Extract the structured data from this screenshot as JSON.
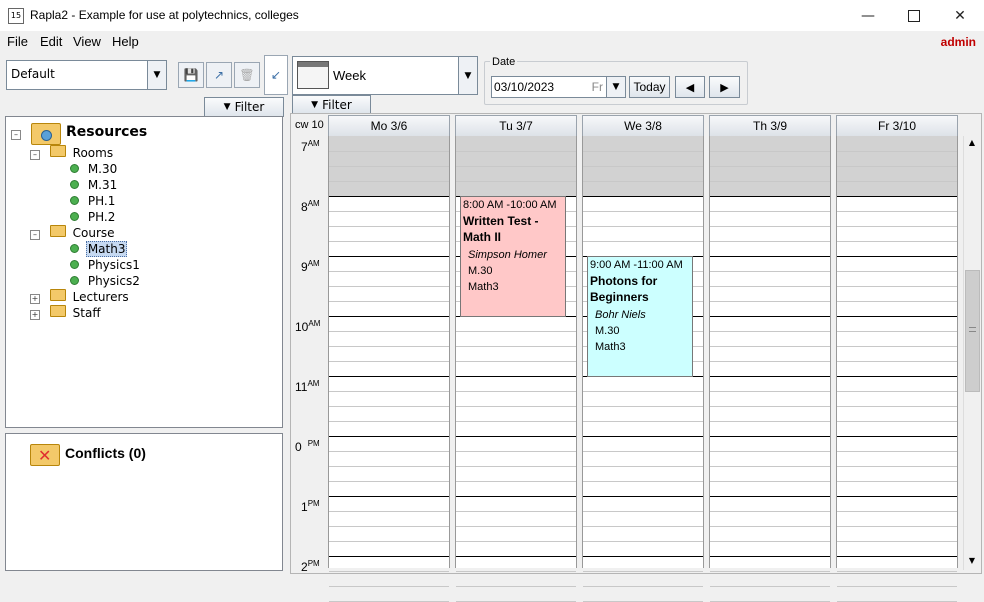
{
  "window": {
    "title": "Rapla2 - Example for use at polytechnics, colleges",
    "icon_text": "15"
  },
  "menu": {
    "items": [
      "File",
      "Edit",
      "View",
      "Help"
    ],
    "user": "admin"
  },
  "left": {
    "view_select": "Default",
    "filter_label": "Filter",
    "tree": {
      "root": "Resources",
      "rooms": {
        "label": "Rooms",
        "items": [
          "M.30",
          "M.31",
          "PH.1",
          "PH.2"
        ]
      },
      "course": {
        "label": "Course",
        "items": [
          "Math3",
          "Physics1",
          "Physics2"
        ]
      },
      "lecturers": "Lecturers",
      "staff": "Staff"
    },
    "conflicts": "Conflicts (0)"
  },
  "calendar": {
    "view_mode": "Week",
    "filter_label": "Filter",
    "date_group_label": "Date",
    "date_value": "03/10/2023",
    "date_day": "Fr",
    "today_label": "Today",
    "week_label": "cw 10",
    "days": [
      "Mo 3/6",
      "Tu 3/7",
      "We 3/8",
      "Th 3/9",
      "Fr 3/10"
    ],
    "hours": [
      {
        "h": "7",
        "ampm": "AM"
      },
      {
        "h": "8",
        "ampm": "AM"
      },
      {
        "h": "9",
        "ampm": "AM"
      },
      {
        "h": "10",
        "ampm": "AM"
      },
      {
        "h": "11",
        "ampm": "AM"
      },
      {
        "h": "0",
        "ampm": "PM"
      },
      {
        "h": "1",
        "ampm": "PM"
      },
      {
        "h": "2",
        "ampm": "PM"
      }
    ],
    "events": [
      {
        "day": "Tu 3/7",
        "time": "8:00 AM -10:00 AM",
        "title": "Written Test - Math II",
        "person": "Simpson Homer",
        "room": "M.30",
        "course": "Math3",
        "color": "#ffc8c8"
      },
      {
        "day": "We 3/8",
        "time": "9:00 AM -11:00 AM",
        "title": "Photons for Beginners",
        "person": "Bohr Niels",
        "room": "M.30",
        "course": "Math3",
        "color": "#ccffff"
      }
    ]
  },
  "colors": {
    "accent": "#c00000",
    "selection": "#c6d9f1",
    "event_pink": "#ffc8c8",
    "event_cyan": "#ccffff",
    "closed_hours": "#d2d2d2"
  }
}
